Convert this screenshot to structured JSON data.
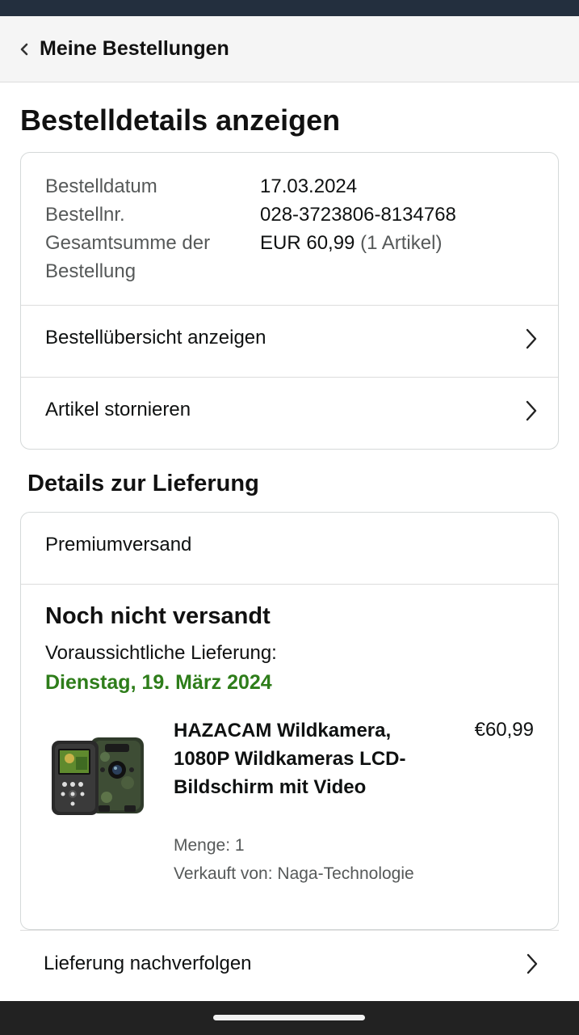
{
  "header": {
    "back_label": "Meine Bestellungen"
  },
  "page": {
    "title": "Bestelldetails anzeigen"
  },
  "order_summary": {
    "rows": [
      {
        "label": "Bestelldatum",
        "value": "17.03.2024"
      },
      {
        "label": "Bestellnr.",
        "value": "028-3723806-8134768"
      },
      {
        "label": "Gesamtsumme der Bestellung",
        "value": "EUR 60,99",
        "value_suffix": "(1 Artikel)"
      }
    ],
    "links": [
      {
        "label": "Bestellübersicht anzeigen"
      },
      {
        "label": "Artikel stornieren"
      }
    ]
  },
  "delivery": {
    "section_title": "Details zur Lieferung",
    "shipping_method": "Premiumversand",
    "status": "Noch nicht versandt",
    "eta_label": "Voraussichtliche Lieferung:",
    "eta_date": "Dienstag, 19. März 2024",
    "eta_color": "#2e7d1a",
    "item": {
      "title": "HAZACAM Wildkamera, 1080P Wildkameras LCD-Bildschirm mit Video",
      "price": "€60,99",
      "quantity": "Menge: 1",
      "seller": "Verkauft von: Naga-Technologie",
      "image": "trail-camera-product-image"
    },
    "track_label": "Lieferung nachverfolgen"
  },
  "icons": {
    "back": "chevron-left-icon",
    "row_arrow": "chevron-right-icon"
  }
}
